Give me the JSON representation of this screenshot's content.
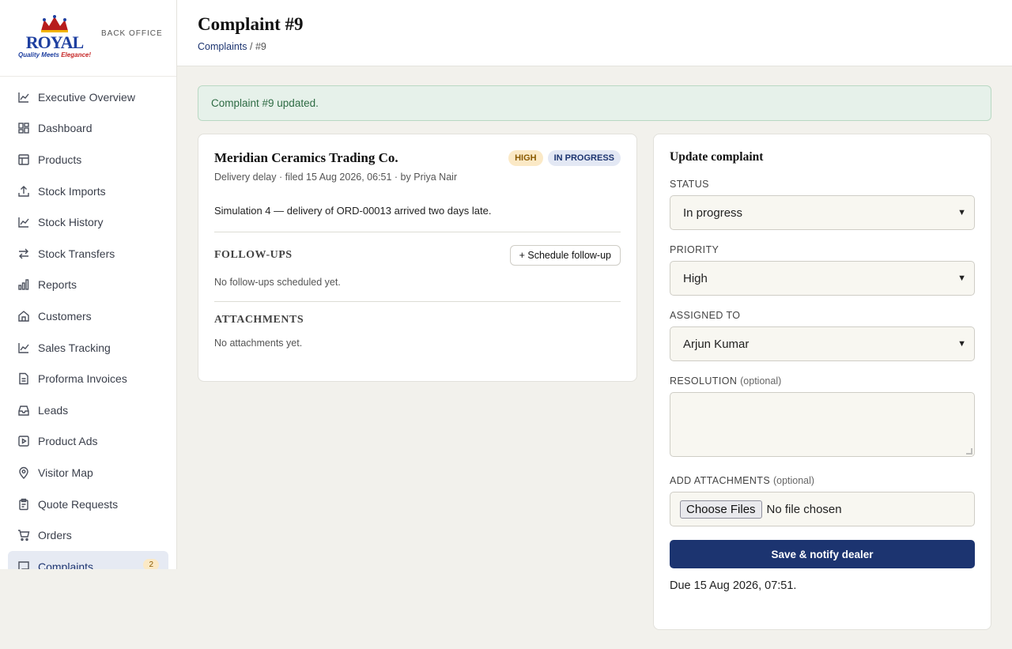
{
  "brand": {
    "logo_word": "ROYAL",
    "logo_tag_a": "Quality Meets ",
    "logo_tag_b": "Elegance!",
    "section": "BACK OFFICE"
  },
  "sidebar": {
    "items": [
      {
        "label": "Executive Overview",
        "icon": "trend-icon"
      },
      {
        "label": "Dashboard",
        "icon": "grid-icon"
      },
      {
        "label": "Products",
        "icon": "box-icon"
      },
      {
        "label": "Stock Imports",
        "icon": "upload-icon"
      },
      {
        "label": "Stock History",
        "icon": "trend-icon"
      },
      {
        "label": "Stock Transfers",
        "icon": "swap-icon"
      },
      {
        "label": "Reports",
        "icon": "bar-chart-icon"
      },
      {
        "label": "Customers",
        "icon": "store-icon"
      },
      {
        "label": "Sales Tracking",
        "icon": "trend-icon"
      },
      {
        "label": "Proforma Invoices",
        "icon": "document-icon"
      },
      {
        "label": "Leads",
        "icon": "inbox-icon"
      },
      {
        "label": "Product Ads",
        "icon": "play-icon"
      },
      {
        "label": "Visitor Map",
        "icon": "pin-icon"
      },
      {
        "label": "Quote Requests",
        "icon": "clipboard-icon"
      },
      {
        "label": "Orders",
        "icon": "cart-icon"
      },
      {
        "label": "Complaints",
        "icon": "message-icon",
        "badge": "2"
      }
    ]
  },
  "header": {
    "title": "Complaint #9",
    "breadcrumb_link": "Complaints",
    "breadcrumb_rest": " / #9"
  },
  "alert": {
    "text": "Complaint #9 updated."
  },
  "complaint": {
    "customer": "Meridian Ceramics Trading Co.",
    "meta": "Delivery delay · filed 15 Aug 2026, 06:51 · by Priya Nair",
    "priority_badge": "HIGH",
    "status_badge": "IN PROGRESS",
    "description": "Simulation 4 — delivery of ORD-00013 arrived two days late.",
    "followups_title": "FOLLOW-UPS",
    "schedule_button": "+ Schedule follow-up",
    "followups_empty": "No follow-ups scheduled yet.",
    "attachments_title": "ATTACHMENTS",
    "attachments_empty": "No attachments yet."
  },
  "form": {
    "title": "Update complaint",
    "status_label": "STATUS",
    "status_value": "In progress",
    "priority_label": "PRIORITY",
    "priority_value": "High",
    "assigned_label": "ASSIGNED TO",
    "assigned_value": "Arjun Kumar",
    "resolution_label": "RESOLUTION",
    "resolution_optional": "(optional)",
    "attachments_label": "ADD ATTACHMENTS",
    "attachments_optional": "(optional)",
    "file_button": "Choose Files",
    "file_status": "No file chosen",
    "submit_label": "Save & notify dealer",
    "due_text": "Due 15 Aug 2026, 07:51."
  },
  "colors": {
    "primary": "#1c3470",
    "success_bg": "#e6f1ea",
    "badge_high_bg": "#fbe9c6",
    "badge_progress_bg": "#e3e8f4"
  }
}
